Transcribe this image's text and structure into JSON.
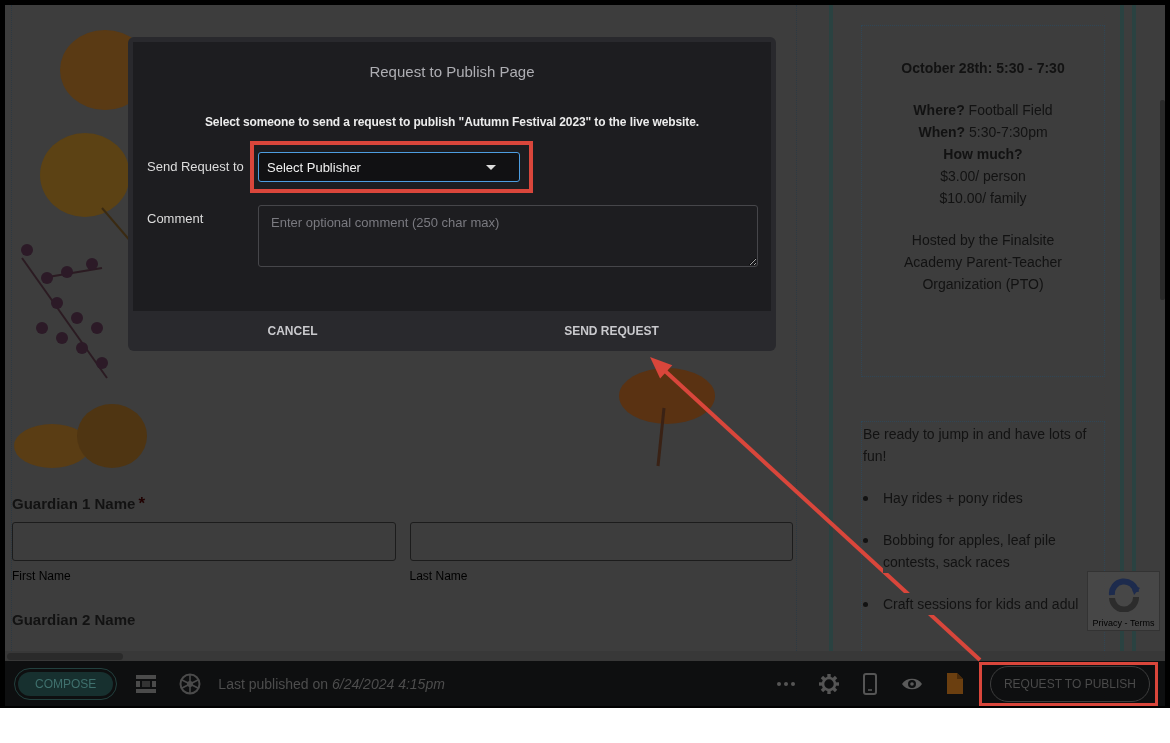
{
  "page": {
    "form": {
      "fields": [
        {
          "label": "Guardian 1 Name",
          "required_mark": "*",
          "inputs": [
            {
              "sublabel": "First Name"
            },
            {
              "sublabel": "Last Name"
            }
          ]
        },
        {
          "label": "Guardian 2 Name"
        }
      ]
    },
    "event_box": {
      "paragraphs": [
        {
          "kind": "heading",
          "lines": [
            "October 28th: 5:30 - 7:30"
          ]
        },
        {
          "kind": "text",
          "lines": [
            "**Where?** Football Field",
            "**When?** 5:30-7:30pm",
            "**How much?**",
            "$3.00/ person",
            "$10.00/ family"
          ]
        },
        {
          "kind": "text",
          "lines": [
            "Hosted by the Finalsite",
            "Academy Parent-Teacher",
            "Organization (PTO)"
          ]
        }
      ]
    },
    "info_box": {
      "intro": "Be ready to jump in and have lots of fun!",
      "bullets": [
        "Hay rides + pony rides",
        "Bobbing for apples, leaf pile contests, sack races",
        "Craft sessions for kids and adul"
      ]
    },
    "recaptcha": {
      "links": "Privacy - Terms"
    }
  },
  "dialog": {
    "title": "Request to Publish Page",
    "message": "Select someone to send a request to publish \"Autumn Festival 2023\" to the live website.",
    "fields": [
      {
        "kind": "select",
        "label": "Send Request to",
        "value": "Select Publisher",
        "highlighted": true
      },
      {
        "kind": "textarea",
        "label": "Comment",
        "placeholder": "Enter optional comment (250 char max)"
      }
    ],
    "buttons": [
      {
        "label": "CANCEL"
      },
      {
        "label": "SEND REQUEST"
      }
    ]
  },
  "bottom_bar": {
    "compose_button": "COMPOSE",
    "status": "Last published on *6/24/2024 4:15pm*",
    "publish_button": {
      "label": "REQUEST TO PUBLISH",
      "highlighted": true
    }
  }
}
